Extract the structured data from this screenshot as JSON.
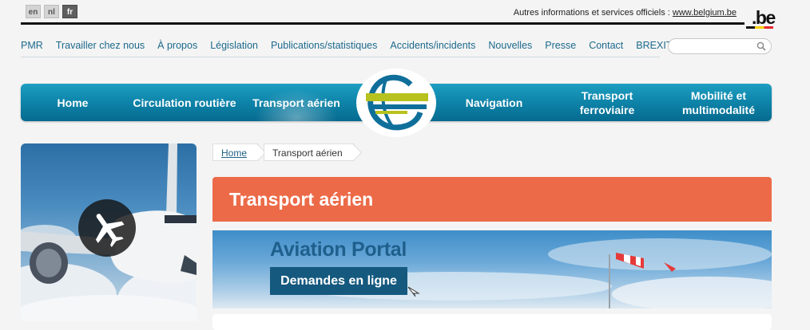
{
  "languages": [
    {
      "code": "en",
      "active": false
    },
    {
      "code": "nl",
      "active": false
    },
    {
      "code": "fr",
      "active": true
    }
  ],
  "official": {
    "text": "Autres informations et services officiels :",
    "link": "www.belgium.be"
  },
  "be_logo": ".be",
  "service_nav": [
    "PMR",
    "Travailler chez nous",
    "À propos",
    "Législation",
    "Publications/statistiques",
    "Accidents/incidents",
    "Nouvelles",
    "Presse",
    "Contact",
    "BREXIT"
  ],
  "search": {
    "placeholder": "",
    "icon": "search-icon"
  },
  "main_nav": [
    {
      "label": "Home",
      "current": false
    },
    {
      "label": "Circulation routière",
      "current": false
    },
    {
      "label": "Transport aérien",
      "current": true
    },
    {
      "label": "Navigation",
      "current": false
    },
    {
      "label": "Transport ferroviaire",
      "current": false
    },
    {
      "label": "Mobilité et multimodalité",
      "current": false
    }
  ],
  "sidebar": {
    "badge_icon": "airplane-icon"
  },
  "breadcrumb": [
    "Home",
    "Transport aérien"
  ],
  "page_title": "Transport aérien",
  "portal": {
    "title": "Aviation Portal",
    "cta": "Demandes en ligne"
  },
  "colors": {
    "nav_blue": "#0f86ab",
    "title_orange": "#ec6a48",
    "link_blue": "#1d6a8c",
    "portal_navy": "#15597f"
  }
}
